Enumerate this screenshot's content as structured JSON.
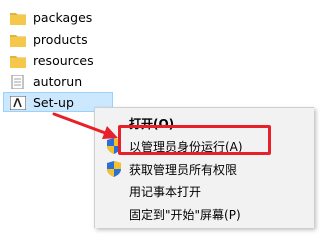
{
  "files": [
    {
      "name": "packages",
      "icon": "folder-icon"
    },
    {
      "name": "products",
      "icon": "folder-icon"
    },
    {
      "name": "resources",
      "icon": "folder-icon"
    },
    {
      "name": "autorun",
      "icon": "file-icon"
    },
    {
      "name": "Set-up",
      "icon": "adobe-setup-icon",
      "selected": true
    }
  ],
  "context_menu": {
    "items": [
      {
        "label": "打开(O)",
        "bold": true
      },
      {
        "label": "以管理员身份运行(A)",
        "icon": "uac-shield-icon"
      },
      {
        "label": "获取管理员所有权限",
        "icon": "uac-shield-icon"
      },
      {
        "label": "用记事本打开"
      },
      {
        "label": "固定到\"开始\"屏幕(P)"
      }
    ]
  },
  "colors": {
    "highlight": "#e8202a",
    "folder": "#f5c84c",
    "selection_bg": "#cce8ff"
  }
}
